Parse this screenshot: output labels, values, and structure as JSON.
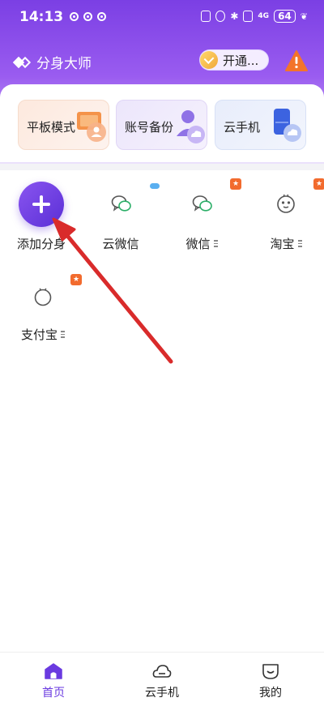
{
  "status_bar": {
    "time": "14:13",
    "network": "4G",
    "battery": "64"
  },
  "header": {
    "brand_name": "分身大师",
    "vip_button_label": "开通...",
    "alert_icon": "warning-icon"
  },
  "feature_cards": [
    {
      "label": "平板模式",
      "icon": "tablet-user-icon"
    },
    {
      "label": "账号备份",
      "icon": "account-backup-icon"
    },
    {
      "label": "云手机",
      "icon": "cloud-phone-icon"
    }
  ],
  "apps": [
    {
      "label": "添加分身",
      "icon": "plus-icon"
    },
    {
      "label": "云微信",
      "icon": "wechat-icon",
      "badge": "cloud"
    },
    {
      "label": "微信",
      "icon": "wechat-icon",
      "badge": "favorite"
    },
    {
      "label": "淘宝",
      "icon": "taobao-icon",
      "badge": "favorite"
    },
    {
      "label": "支付宝",
      "icon": "alipay-icon",
      "badge": "favorite"
    }
  ],
  "tabs": [
    {
      "label": "首页",
      "icon": "home-icon",
      "active": true
    },
    {
      "label": "云手机",
      "icon": "cloud-icon",
      "active": false
    },
    {
      "label": "我的",
      "icon": "profile-icon",
      "active": false
    }
  ],
  "colors": {
    "accent": "#6a3ae0",
    "header_gradient_top": "#7b3fe4",
    "badge_orange": "#f26b2e",
    "annotation_arrow": "#d92b2b"
  }
}
